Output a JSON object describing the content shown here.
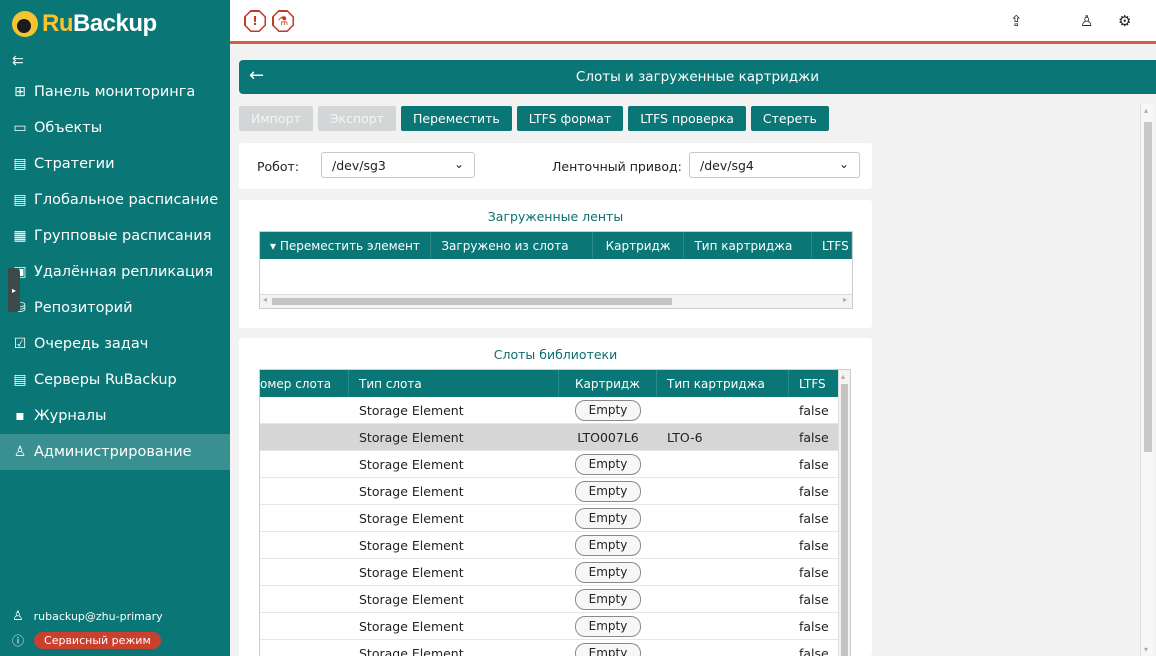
{
  "brand": {
    "part1": "Ru",
    "part2": "Backup"
  },
  "sidebar": {
    "collapse_icon": "⇇",
    "items": [
      {
        "icon": "⊞",
        "label": "Панель мониторинга"
      },
      {
        "icon": "▭",
        "label": "Объекты"
      },
      {
        "icon": "▤",
        "label": "Стратегии"
      },
      {
        "icon": "▤",
        "label": "Глобальное расписание"
      },
      {
        "icon": "▦",
        "label": "Групповые расписания"
      },
      {
        "icon": "▣",
        "label": "Удалённая репликация"
      },
      {
        "icon": "⛁",
        "label": "Репозиторий"
      },
      {
        "icon": "☑",
        "label": "Очередь задач"
      },
      {
        "icon": "▤",
        "label": "Серверы RuBackup"
      },
      {
        "icon": "▪",
        "label": "Журналы"
      },
      {
        "icon": "♙",
        "label": "Администрирование"
      }
    ],
    "user": "rubackup@zhu-primary",
    "service_mode": "Сервисный режим"
  },
  "topbar": {
    "alert_icon": "!",
    "flask_icon": "⚗",
    "upload_icon": "⇪",
    "user_icon": "♙",
    "settings_icon": "⚙"
  },
  "header": {
    "back_icon": "←",
    "title": "Слоты и загруженные картриджи"
  },
  "toolbar": {
    "import": "Импорт",
    "export": "Экспорт",
    "move": "Переместить",
    "ltfs_format": "LTFS формат",
    "ltfs_check": "LTFS проверка",
    "erase": "Стереть"
  },
  "robot": {
    "label": "Робот:",
    "value": "/dev/sg3",
    "drive_label": "Ленточный привод:",
    "drive_value": "/dev/sg4"
  },
  "loaded": {
    "title": "Загруженные ленты",
    "columns": [
      "▾ Переместить элемент",
      "Загружено из слота",
      "Картридж",
      "Тип картриджа",
      "LTFS"
    ]
  },
  "slots": {
    "title": "Слоты библиотеки",
    "columns": [
      "омер слота",
      "Тип слота",
      "Картридж",
      "Тип картриджа",
      "LTFS"
    ],
    "rows": [
      {
        "type": "Storage Element",
        "cartridge": "Empty",
        "ctype": "",
        "ltfs": "false"
      },
      {
        "type": "Storage Element",
        "cartridge": "LTO007L6",
        "ctype": "LTO-6",
        "ltfs": "false"
      },
      {
        "type": "Storage Element",
        "cartridge": "Empty",
        "ctype": "",
        "ltfs": "false"
      },
      {
        "type": "Storage Element",
        "cartridge": "Empty",
        "ctype": "",
        "ltfs": "false"
      },
      {
        "type": "Storage Element",
        "cartridge": "Empty",
        "ctype": "",
        "ltfs": "false"
      },
      {
        "type": "Storage Element",
        "cartridge": "Empty",
        "ctype": "",
        "ltfs": "false"
      },
      {
        "type": "Storage Element",
        "cartridge": "Empty",
        "ctype": "",
        "ltfs": "false"
      },
      {
        "type": "Storage Element",
        "cartridge": "Empty",
        "ctype": "",
        "ltfs": "false"
      },
      {
        "type": "Storage Element",
        "cartridge": "Empty",
        "ctype": "",
        "ltfs": "false"
      },
      {
        "type": "Storage Element",
        "cartridge": "Empty",
        "ctype": "",
        "ltfs": "false"
      }
    ]
  }
}
